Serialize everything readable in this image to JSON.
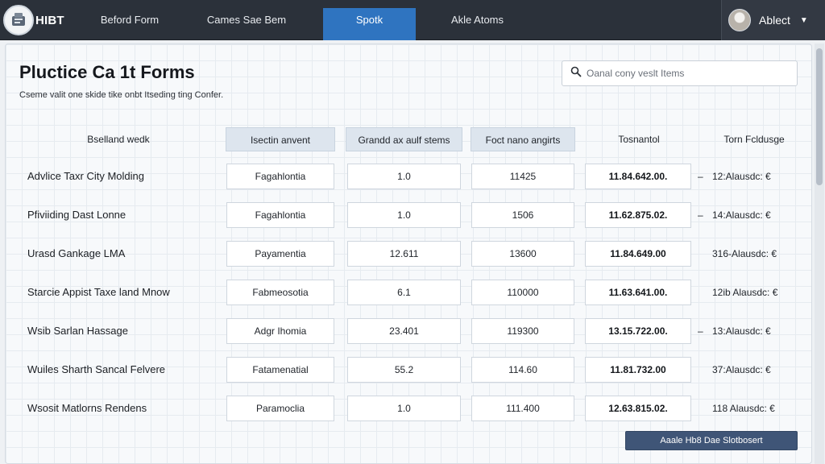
{
  "nav": {
    "logo_text": "HIBT",
    "items": [
      {
        "label": "Beford Form"
      },
      {
        "label": "Cames Sae Bem"
      },
      {
        "label": "Spotk"
      },
      {
        "label": "Akle Atoms"
      }
    ],
    "active_index": 2,
    "user_label": "Ablect"
  },
  "page": {
    "title": "Pluctice Ca 1t Forms",
    "subtitle": "Cseme valit one skide tike onbt Itseding ting Confer.",
    "search_placeholder": "Oanal cony veslt Items"
  },
  "table": {
    "headers": [
      "Bselland wedk",
      "Isectin anvent",
      "Grandd ax aulf stems",
      "Foct nano angirts",
      "Tosnantol",
      "Torn Fcldusge"
    ],
    "rows": [
      {
        "name": "Advlice Taxr City Molding",
        "c1": "Fagahlontia",
        "c2": "1.0",
        "c3": "11425",
        "c4": "11.84.642.00.",
        "dash": "–",
        "c5": "12:Alausdc: €"
      },
      {
        "name": "Pfiviiding Dast Lonne",
        "c1": "Fagahlontia",
        "c2": "1.0",
        "c3": "1506",
        "c4": "11.62.875.02.",
        "dash": "–",
        "c5": "14:Alausdc: €"
      },
      {
        "name": "Urasd Gankage LMA",
        "c1": "Payamentia",
        "c2": "12.611",
        "c3": "13600",
        "c4": "11.84.649.00",
        "dash": "",
        "c5": "316-Alausdc: €"
      },
      {
        "name": "Starcie Appist Taxe land Mnow",
        "c1": "Fabmeosotia",
        "c2": "6.1",
        "c3": "110000",
        "c4": "11.63.641.00.",
        "dash": "",
        "c5": "12ib Alausdc: €"
      },
      {
        "name": "Wsib Sarlan Hassage",
        "c1": "Adgr Ihomia",
        "c2": "23.401",
        "c3": "119300",
        "c4": "13.15.722.00.",
        "dash": "–",
        "c5": "13:Alausdc: €"
      },
      {
        "name": "Wuiles Sharth Sancal Felvere",
        "c1": "Fatamenatial",
        "c2": "55.2",
        "c3": "114.60",
        "c4": "11.81.732.00",
        "dash": "",
        "c5": "37:Alausdc: €"
      },
      {
        "name": "Wsosit Matlorns Rendens",
        "c1": "Paramoclia",
        "c2": "1.0",
        "c3": "111.400",
        "c4": "12.63.815.02.",
        "dash": "",
        "c5": "118 Alausdc: €"
      }
    ]
  },
  "action_button_label": "Aaale Hb8 Dae Slotbosert",
  "colors": {
    "topbar": "#2b313a",
    "active_nav": "#2f74c0",
    "header_cell": "#dde5ee",
    "action_button": "#3f5577"
  },
  "icons": {
    "logo": "logo-icon",
    "search": "search-icon",
    "avatar": "user-avatar",
    "dropdown": "chevron-down-icon"
  }
}
